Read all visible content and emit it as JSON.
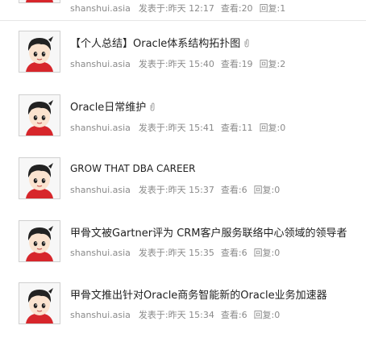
{
  "threads": [
    {
      "title": "",
      "attachment": false,
      "user": "shanshui.asia",
      "posted_label": "发表于:",
      "posted_time": "昨天 12:17",
      "views_label": "查看:",
      "views": "20",
      "replies_label": "回复:",
      "replies": "1"
    },
    {
      "title": "【个人总结】Oracle体系结构拓扑图",
      "attachment": true,
      "user": "shanshui.asia",
      "posted_label": "发表于:",
      "posted_time": "昨天 15:40",
      "views_label": "查看:",
      "views": "19",
      "replies_label": "回复:",
      "replies": "2"
    },
    {
      "title": "Oracle日常维护",
      "attachment": true,
      "user": "shanshui.asia",
      "posted_label": "发表于:",
      "posted_time": "昨天 15:41",
      "views_label": "查看:",
      "views": "11",
      "replies_label": "回复:",
      "replies": "0"
    },
    {
      "title": "GROW THAT DBA CAREER",
      "attachment": false,
      "user": "shanshui.asia",
      "posted_label": "发表于:",
      "posted_time": "昨天 15:37",
      "views_label": "查看:",
      "views": "6",
      "replies_label": "回复:",
      "replies": "0"
    },
    {
      "title": "甲骨文被Gartner评为 CRM客户服务联络中心领域的领导者",
      "attachment": false,
      "user": "shanshui.asia",
      "posted_label": "发表于:",
      "posted_time": "昨天 15:35",
      "views_label": "查看:",
      "views": "6",
      "replies_label": "回复:",
      "replies": "0"
    },
    {
      "title": "甲骨文推出针对Oracle商务智能新的Oracle业务加速器",
      "attachment": false,
      "user": "shanshui.asia",
      "posted_label": "发表于:",
      "posted_time": "昨天 15:34",
      "views_label": "查看:",
      "views": "6",
      "replies_label": "回复:",
      "replies": "0"
    }
  ],
  "icons": {
    "avatar": "cartoon-boy-avatar-icon",
    "attachment": "paperclip-icon"
  },
  "colors": {
    "title_text": "#222222",
    "meta_text": "#8a8a8a",
    "divider": "#e6e6e6"
  }
}
